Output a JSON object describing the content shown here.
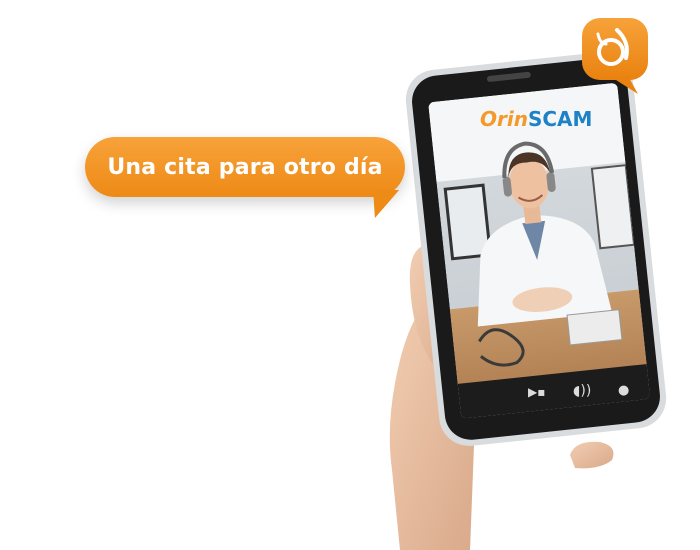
{
  "bubble": {
    "text": "Una cita para otro día"
  },
  "logo": {
    "part1": "Orin",
    "part2": "SCAM"
  },
  "icons": {
    "camera": "video-camera-icon",
    "speaker": "speaker-icon",
    "mic": "microphone-icon"
  },
  "colors": {
    "orange": "#f39a2a",
    "blue": "#1e82c6"
  }
}
